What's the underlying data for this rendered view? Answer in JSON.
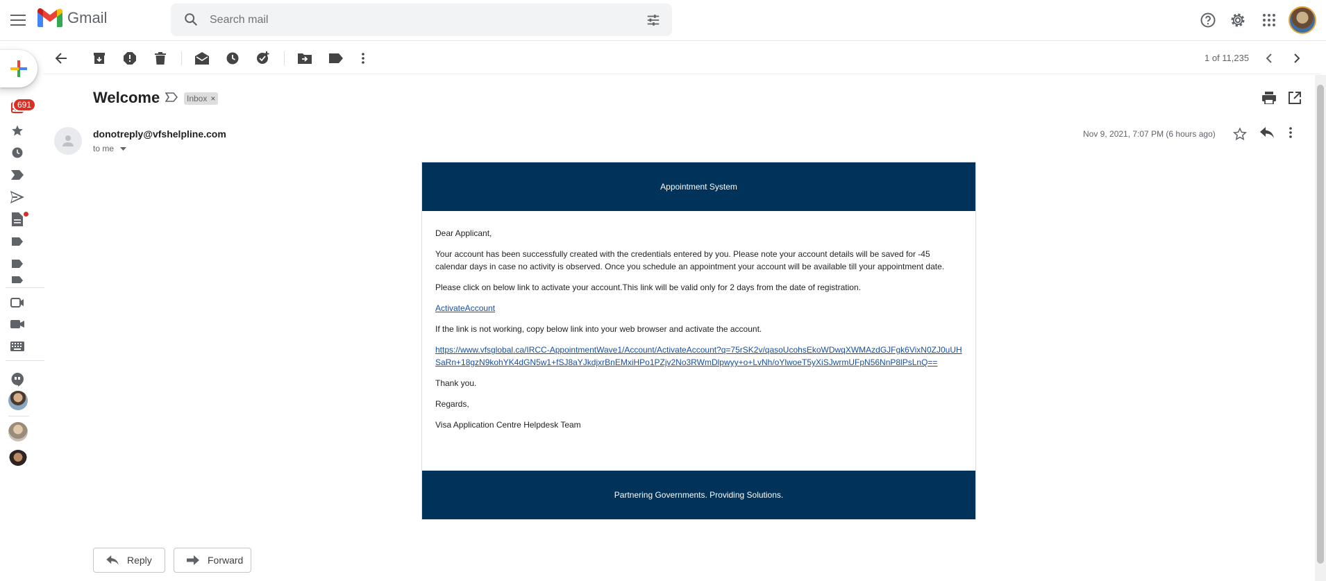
{
  "app": {
    "name": "Gmail"
  },
  "search": {
    "placeholder": "Search mail"
  },
  "rail": {
    "unread_badge": "691"
  },
  "toolbar": {
    "pager": "1 of 11,235"
  },
  "message": {
    "subject": "Welcome",
    "label_chip": "Inbox",
    "label_chip_close": "×",
    "sender": "donotreply@vfshelpline.com",
    "recipient": "to me",
    "date": "Nov 9, 2021, 7:07 PM (6 hours ago)"
  },
  "email_body": {
    "header": "Appointment System",
    "greeting": "Dear Applicant,",
    "paragraph1": "Your account has been successfully created with the credentials entered by you. Please note your account details will be saved for -45 calendar days in case no activity is observed. Once you schedule an appointment your account will be available till your appointment date.",
    "paragraph2": "Please click on below link to activate your account.This link will be valid only for 2 days from the date of registration.",
    "activate_link": "ActivateAccount",
    "paragraph3": "If the link is not working, copy below link into your web browser and activate the account.",
    "activation_url": "https://www.vfsglobal.ca/IRCC-AppointmentWave1/Account/ActivateAccount?q=75rSK2v/qasoUcohsEkoWDwqXWMAzdGJFgk6VixN0ZJ0uUHSaRn+18gzN9kohYK4dGN5w1+fSJ8aYJkdjxrBnEMxiHPo1PZjv2No3RWmDlpwyy+o+LvNh/oYlwoeT5yXiSJwrmUFpN56NnP8lPsLnQ==",
    "thanks": "Thank you.",
    "regards": "Regards,",
    "signature": "Visa Application Centre Helpdesk Team",
    "footer": "Partnering Governments. Providing Solutions."
  },
  "actions": {
    "reply": "Reply",
    "forward": "Forward"
  },
  "colors": {
    "email_banner": "#00325a",
    "badge": "#d93025",
    "link": "#1a4fa0"
  }
}
